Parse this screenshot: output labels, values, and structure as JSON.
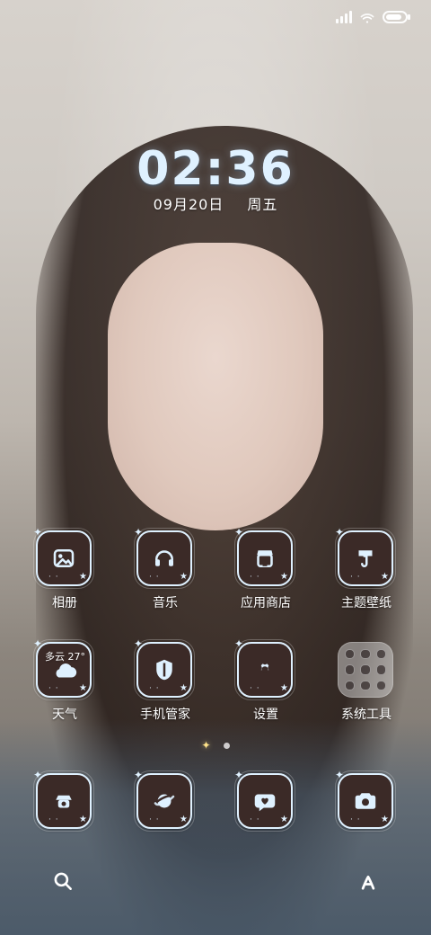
{
  "clock": {
    "time": "02:36",
    "date": "09月20日",
    "weekday": "周五"
  },
  "apps": {
    "row1": [
      {
        "label": "相册",
        "icon": "photo-icon"
      },
      {
        "label": "音乐",
        "icon": "headphones-icon"
      },
      {
        "label": "应用商店",
        "icon": "store-icon"
      },
      {
        "label": "主题壁纸",
        "icon": "paintbrush-icon"
      }
    ],
    "row2": [
      {
        "label": "天气",
        "icon": "weather-cloud-icon",
        "weather": "多云 27°"
      },
      {
        "label": "手机管家",
        "icon": "shield-icon"
      },
      {
        "label": "设置",
        "icon": "gear-icon"
      },
      {
        "label": "系统工具",
        "icon": "folder-icon"
      }
    ],
    "dock": [
      {
        "label": "",
        "icon": "phone-icon"
      },
      {
        "label": "",
        "icon": "planet-icon"
      },
      {
        "label": "",
        "icon": "message-heart-icon"
      },
      {
        "label": "",
        "icon": "camera-icon"
      }
    ]
  },
  "bottom": {
    "left_icon": "search-icon",
    "right_icon": "assistant-icon"
  },
  "colors": {
    "accent": "#dff1ff",
    "icon_bg": "#3b2a27",
    "pager_star": "#ffe38a"
  }
}
